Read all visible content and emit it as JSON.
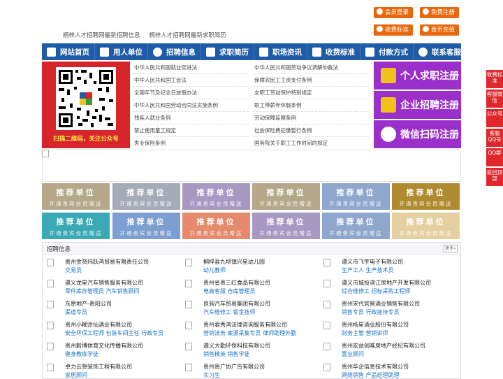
{
  "top_buttons": [
    {
      "label": "会员登录"
    },
    {
      "label": "免费注册"
    },
    {
      "label": "收费标准"
    },
    {
      "label": "金币充值"
    }
  ],
  "top_links": [
    "桐梓人才招聘网最新招聘信息",
    "桐梓人才招聘网最新求职简历"
  ],
  "nav": [
    "网站首页",
    "用人单位",
    "招聘信息",
    "求职简历",
    "职场资讯",
    "收费标准",
    "付款方式",
    "联系客服"
  ],
  "qr_caption": "扫描二维码，关注公众号",
  "left_links": [
    "中华人民共和国就业促进法",
    "中华人民共和国工会法",
    "全国年节及纪念日放假办法",
    "中华人民共和国劳动合同法实施条例",
    "残疾人就业条例",
    "禁止使用童工规定",
    "失业保险条例"
  ],
  "right_links": [
    "中华人民共和国劳动争议调解仲裁法",
    "保障农民工工资支付条例",
    "女职工劳动保护特别规定",
    "职工带薪年休假条例",
    "劳动保障监察条例",
    "社会保险费征缴暂行条例",
    "国务院关于职工工作时间的规定"
  ],
  "register": [
    "个人求职注册",
    "企业招聘注册",
    "微信扫码注册"
  ],
  "side": [
    "收费标准",
    "客服微信",
    "公众号",
    "客服QQ号",
    "QQ群",
    "返回顶部"
  ],
  "ad_title": "推荐单位",
  "ad_sub": "开通贵宾会员赠送",
  "ad_colors": [
    "#b5a88a",
    "#a5acb8",
    "#a899c2",
    "#b5a88a",
    "#8fa7cc",
    "#b08a2e",
    "#3aa8b5",
    "#7c9ed0",
    "#e58a6c",
    "#a899c2",
    "#8fa7cc",
    "#e8dfcf",
    "#e6cfa0"
  ],
  "jobs_title": "招聘信息",
  "more": "更多»",
  "jobs": [
    [
      {
        "company": "贵州金贤炜跃鸿贸易有限责任公司",
        "positions": "交易员"
      },
      {
        "company": "桐梓县九坝镇兴星幼儿园",
        "positions": "幼儿教师"
      },
      {
        "company": "遵义市飞宇电子有限公司",
        "positions": "生产工人  生产技术员"
      }
    ],
    [
      {
        "company": "遵义龙星汽车销售服务有限公司",
        "positions": "零件库存管理员  汽车销售顾问"
      },
      {
        "company": "贵州省贵三红食品有限公司",
        "positions": "电商客服  仓库管理员"
      },
      {
        "company": "遵义市城投滨江房地产开发有限公司",
        "positions": "综合维修工  招标采购工程师"
      }
    ],
    [
      {
        "company": "东原地产-贵阳公司",
        "positions": "渠道专员"
      },
      {
        "company": "良驹汽车贸易集团有限公司",
        "positions": "汽车维修工  钣金技师"
      },
      {
        "company": "贵州宋代官窖酒业销售有限公司",
        "positions": "销售专员  行政接待专员"
      }
    ],
    [
      {
        "company": "贵州小糊涂仙酒业有限公司",
        "positions": "安全环保工程师  包装车间主任  行政专员"
      },
      {
        "company": "贵州君秀鸿法律咨询服务有限公司",
        "positions": "营销法务  案源采集专员  律师助理外勤"
      },
      {
        "company": "贵州杨星酒业股份有限公司",
        "positions": "财务主管  营销讲师"
      }
    ],
    [
      {
        "company": "贵州毅博体育文化传播有限公司",
        "positions": "健身教练学徒"
      },
      {
        "company": "遵义大勤环保科技有限公司",
        "positions": "销售精英  销售学徒"
      },
      {
        "company": "贵州宏益创唯房地产经纪有限公司",
        "positions": "置业顾问"
      }
    ],
    [
      {
        "company": "卓力云想装饰工程有限公司",
        "positions": "家居顾问"
      },
      {
        "company": "贵州贵广协广告有限公司",
        "positions": "实习生"
      },
      {
        "company": "贵州华企信息技术有限公司",
        "positions": "网络销售  产品经理助理"
      }
    ]
  ]
}
